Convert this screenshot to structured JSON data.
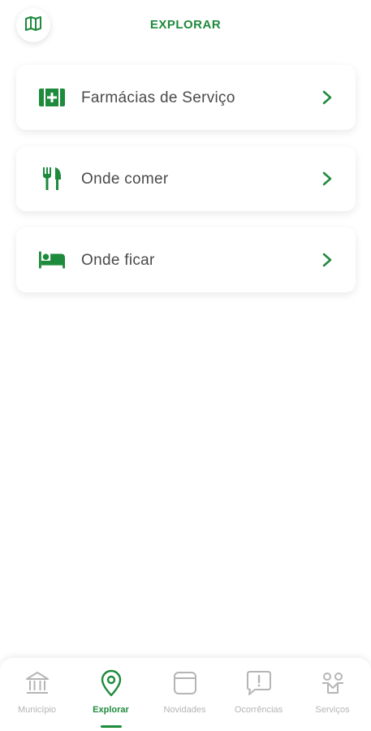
{
  "header": {
    "title": "EXPLORAR",
    "map_button_icon": "map-icon"
  },
  "menu": {
    "items": [
      {
        "label": "Farmácias de Serviço",
        "icon": "pharmacy-icon"
      },
      {
        "label": "Onde comer",
        "icon": "fork-knife-icon"
      },
      {
        "label": "Onde ficar",
        "icon": "bed-icon"
      }
    ]
  },
  "tabbar": {
    "tabs": [
      {
        "label": "Município",
        "icon": "town-hall-icon",
        "active": false
      },
      {
        "label": "Explorar",
        "icon": "location-pin-icon",
        "active": true
      },
      {
        "label": "Novidades",
        "icon": "news-card-icon",
        "active": false
      },
      {
        "label": "Ocorrências",
        "icon": "alert-speech-icon",
        "active": false
      },
      {
        "label": "Serviços",
        "icon": "services-icon",
        "active": false
      }
    ]
  },
  "colors": {
    "accent": "#1e8a3c",
    "inactive": "#b5b5b5",
    "text": "#4a4a4a"
  }
}
